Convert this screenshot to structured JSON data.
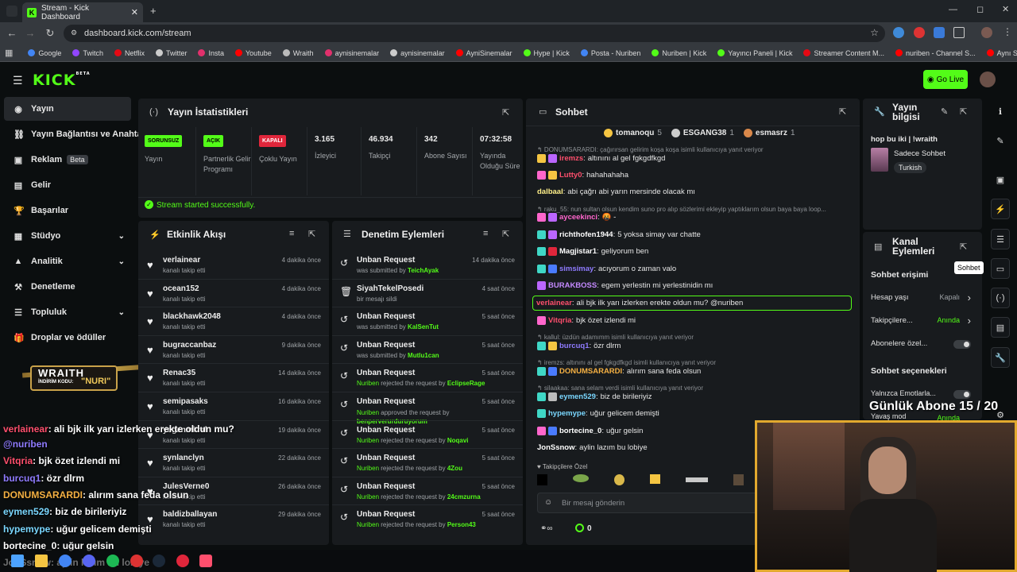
{
  "browser": {
    "tab_title": "Stream - Kick Dashboard",
    "url": "dashboard.kick.com/stream",
    "bookmarks": [
      {
        "label": "Google",
        "color": "#4285f4"
      },
      {
        "label": "Twitch",
        "color": "#9146ff"
      },
      {
        "label": "Netflix",
        "color": "#e50914"
      },
      {
        "label": "Twitter",
        "color": "#cccccc"
      },
      {
        "label": "Insta",
        "color": "#e1306c"
      },
      {
        "label": "Youtube",
        "color": "#ff0000"
      },
      {
        "label": "Wraith",
        "color": "#bbbbbb"
      },
      {
        "label": "aynisinemalar",
        "color": "#e1306c"
      },
      {
        "label": "aynisinemalar",
        "color": "#cccccc"
      },
      {
        "label": "AyniSinemalar",
        "color": "#ff0000"
      },
      {
        "label": "Hype | Kick",
        "color": "#53fc18"
      },
      {
        "label": "Posta - Nuriben",
        "color": "#4285f4"
      },
      {
        "label": "Nuriben | Kick",
        "color": "#53fc18"
      },
      {
        "label": "Yayıncı Paneli | Kick",
        "color": "#53fc18"
      },
      {
        "label": "Streamer Content M...",
        "color": "#e50914"
      },
      {
        "label": "nuriben - Channel S...",
        "color": "#ff0000"
      },
      {
        "label": "Aynı Sinemalar - Ça...",
        "color": "#ff0000"
      }
    ]
  },
  "header": {
    "logo": "KICK",
    "logo_sup": "BETA",
    "go_live": "Go Live"
  },
  "sidebar": {
    "items": [
      {
        "label": "Yayın",
        "icon": "broadcast-icon"
      },
      {
        "label": "Yayın Bağlantısı ve Anahtarı",
        "icon": "link-icon"
      },
      {
        "label": "Reklam",
        "icon": "ad-icon",
        "badge": "Beta"
      },
      {
        "label": "Gelir",
        "icon": "wallet-icon"
      },
      {
        "label": "Başarılar",
        "icon": "trophy-icon"
      },
      {
        "label": "Stüdyo",
        "icon": "studio-icon",
        "chevron": "⌄"
      },
      {
        "label": "Analitik",
        "icon": "chart-icon",
        "chevron": "⌄"
      },
      {
        "label": "Denetleme",
        "icon": "hammer-icon"
      },
      {
        "label": "Topluluk",
        "icon": "community-icon",
        "chevron": "⌄"
      },
      {
        "label": "Droplar ve ödüller",
        "icon": "gift-icon"
      }
    ]
  },
  "stats": {
    "title": "Yayın İstatistikleri",
    "items": [
      {
        "badge": "SORUNSUZ",
        "badge_color": "#53fc18",
        "label": "Yayın"
      },
      {
        "badge": "AÇIK",
        "badge_color": "#53fc18",
        "label": "Partnerlik Gelir Programı"
      },
      {
        "badge": "KAPALI",
        "badge_color": "#e0263b",
        "label": "Çoklu Yayın"
      },
      {
        "value": "3.165",
        "label": "İzleyici"
      },
      {
        "value": "46.934",
        "label": "Takipçi"
      },
      {
        "value": "342",
        "label": "Abone Sayısı"
      },
      {
        "value": "07:32:58",
        "label": "Yayında Olduğu Süre"
      }
    ],
    "success": "Stream started successfully."
  },
  "activity": {
    "title": "Etkinlik Akışı",
    "rows": [
      {
        "name": "verlainear",
        "sub": "kanalı takip etti",
        "time": "4 dakika önce"
      },
      {
        "name": "ocean152",
        "sub": "kanalı takip etti",
        "time": "4 dakika önce"
      },
      {
        "name": "blackhawk2048",
        "sub": "kanalı takip etti",
        "time": "4 dakika önce"
      },
      {
        "name": "bugraccanbaz",
        "sub": "kanalı takip etti",
        "time": "9 dakika önce"
      },
      {
        "name": "Renac35",
        "sub": "kanalı takip etti",
        "time": "14 dakika önce"
      },
      {
        "name": "semipasaks",
        "sub": "kanalı takip etti",
        "time": "16 dakika önce"
      },
      {
        "name": "yegenmkral",
        "sub": "kanalı takip etti",
        "time": "19 dakika önce"
      },
      {
        "name": "synlanclyn",
        "sub": "kanalı takip etti",
        "time": "22 dakika önce"
      },
      {
        "name": "JulesVerne0",
        "sub": "kanalı takip etti",
        "time": "26 dakika önce"
      },
      {
        "name": "baldizballayan",
        "sub": "kanalı takip etti",
        "time": "29 dakika önce"
      }
    ]
  },
  "moderation": {
    "title": "Denetim Eylemleri",
    "rows": [
      {
        "name": "Unban Request",
        "pre": "was submitted by ",
        "who": "TeichAyak",
        "time": "14 dakika önce",
        "icon": "undo-icon"
      },
      {
        "name": "SiyahTekelPosedi",
        "pre": "bir mesajı sildi",
        "who": "",
        "time": "4 saat önce",
        "icon": "trash-icon"
      },
      {
        "name": "Unban Request",
        "pre": "was submitted by ",
        "who": "KalSenTut",
        "time": "5 saat önce",
        "icon": "undo-icon"
      },
      {
        "name": "Unban Request",
        "pre": "was submitted by ",
        "who": "Mutlu1can",
        "time": "5 saat önce",
        "icon": "undo-icon"
      },
      {
        "name": "Unban Request",
        "by": "Nuriben",
        "pre": " rejected the request by ",
        "who": "EclipseRage",
        "time": "5 saat önce",
        "icon": "undo-icon"
      },
      {
        "name": "Unban Request",
        "by": "Nuriben",
        "pre": " approved the request by ",
        "who": "benperverurduruyorum",
        "time": "5 saat önce",
        "icon": "undo-icon"
      },
      {
        "name": "Unban Request",
        "by": "Nuriben",
        "pre": " rejected the request by ",
        "who": "Noqavi",
        "time": "5 saat önce",
        "icon": "undo-icon"
      },
      {
        "name": "Unban Request",
        "by": "Nuriben",
        "pre": " rejected the request by ",
        "who": "4Zou",
        "time": "5 saat önce",
        "icon": "undo-icon"
      },
      {
        "name": "Unban Request",
        "by": "Nuriben",
        "pre": " rejected the request by ",
        "who": "24cmzurna",
        "time": "5 saat önce",
        "icon": "undo-icon"
      },
      {
        "name": "Unban Request",
        "by": "Nuriben",
        "pre": " rejected the request by ",
        "who": "Person43",
        "time": "5 saat önce",
        "icon": "undo-icon"
      }
    ]
  },
  "chat": {
    "title": "Sohbet",
    "top_gifters": [
      {
        "name": "tomanoqu",
        "count": "5",
        "color": "#f5c542"
      },
      {
        "name": "ESGANG38",
        "count": "1",
        "color": "#cccccc"
      },
      {
        "name": "esmasrz",
        "count": "1",
        "color": "#d9884a"
      }
    ],
    "messages": [
      {
        "reply": "↰ DONUMSARARDI: çağırırsan gelirim koşa koşa isimli kullanıcıya yanıt veriyor"
      },
      {
        "user": "iremzs",
        "color": "#ff4f6d",
        "text": "altınını al gel fgkgdfkgd",
        "badges": [
          "#f5c542",
          "#bb66ff"
        ]
      },
      {
        "user": "Lutty0",
        "color": "#ff4f6d",
        "text": "hahahahaha",
        "badges": [
          "#ff66cc",
          "#f5c542"
        ]
      },
      {
        "user": "dalbaal",
        "color": "#fff08a",
        "text": "abi çağrı abi yarın mersinde olacak mı",
        "badges": []
      },
      {
        "reply": "↰ raku_55: nun sultan olsun kendim suno pro alıp sözlerimi ekleyip yaptıklarım olsun baya baya loop..."
      },
      {
        "user": "ayceekinci",
        "color": "#ff66cc",
        "text": "🤬 -",
        "badges": [
          "#ff66cc",
          "#bb66ff"
        ]
      },
      {
        "user": "richthofen1944",
        "color": "#ffffff",
        "text": "5 yoksa simay var chatte",
        "badges": [
          "#3fd7c6",
          "#bb66ff"
        ]
      },
      {
        "user": "Magjistar1",
        "color": "#ffffff",
        "text": "geliyorum ben",
        "badges": [
          "#3fd7c6",
          "#e0263b"
        ]
      },
      {
        "user": "simsimay",
        "color": "#8f7bff",
        "text": "acıyorum o zaman valo",
        "badges": [
          "#3fd7c6",
          "#4a7bff"
        ]
      },
      {
        "user": "BURAKBOSS",
        "color": "#c58aff",
        "text": "egem yerlestin mi yerlestinidin mı",
        "badges": [
          "#bb66ff"
        ]
      },
      {
        "user": "verlainear",
        "color": "#ff4f6d",
        "text": "ali bjk ilk yarı izlerken erekte oldun mu? @nuriben",
        "badges": [],
        "highlight": true
      },
      {
        "user": "Vitqria",
        "color": "#ff4f6d",
        "text": "bjk özet izlendi mi",
        "badges": [
          "#ff66cc"
        ]
      },
      {
        "reply": "↰ kallul: üzdün adamımm isimli kullanıcıya yanıt veriyor"
      },
      {
        "user": "burcuq1",
        "color": "#8f7bff",
        "text": "özr dlrm",
        "badges": [
          "#3fd7c6",
          "#f5c542"
        ]
      },
      {
        "reply": "↰ iremzs: altınını al gel fgkgdfkgd isimli kullanıcıya yanıt veriyor"
      },
      {
        "user": "DONUMSARARDI",
        "color": "#f5b042",
        "text": "alırım sana feda olsun",
        "badges": [
          "#3fd7c6",
          "#4a7bff"
        ]
      },
      {
        "reply": "↰ silaakaa: sana selam verdi isimli kullanıcıya yanıt veriyor"
      },
      {
        "user": "eymen529",
        "color": "#7ad7ff",
        "text": "biz de birileriyiz",
        "badges": [
          "#3fd7c6",
          "#bbbbbb"
        ]
      },
      {
        "user": "hypemype",
        "color": "#7ad7ff",
        "text": "uğur gelicem demişti",
        "badges": [
          "#3fd7c6"
        ]
      },
      {
        "user": "bortecine_0",
        "color": "#ffffff",
        "text": "uğur gelsin",
        "badges": [
          "#ff66cc",
          "#4a7bff"
        ]
      },
      {
        "user": "JonSsnow",
        "color": "#ffffff",
        "text": "aylin lazım bu lobiye",
        "badges": []
      }
    ],
    "emote_header": "♥ Takipçilere Özel",
    "input_placeholder": "Bir mesaj gönderin",
    "points": "0"
  },
  "info": {
    "title": "Yayın bilgisi",
    "stream_title": "hop bu iki | !wraith",
    "category": "Sadece Sohbet",
    "tag": "Turkish"
  },
  "channel": {
    "title": "Kanal Eylemleri",
    "chat_access": "Sohbet erişimi",
    "rows": [
      {
        "label": "Hesap yaşı",
        "value": "Kapalı",
        "vcolor": "#9ea2a6",
        "type": "chevron"
      },
      {
        "label": "Takipçilere...",
        "value": "Anında",
        "vcolor": "#53fc18",
        "type": "chevron"
      },
      {
        "label": "Abonelere özel...",
        "value": "",
        "type": "toggle"
      }
    ],
    "chat_options": "Sohbet seçenekleri",
    "rows2": [
      {
        "label": "Yalnızca Emotlarla...",
        "type": "toggle"
      },
      {
        "label": "Yavaş mod",
        "value": "Anında",
        "vcolor": "#53fc18"
      }
    ],
    "tooltip": "Sohbet"
  },
  "overlay": {
    "sponsor_brand": "WRAITH",
    "sponsor_code_label": "İNDİRİM KODU:",
    "sponsor_code": "\"NURI\"",
    "sub_goal": "Günlük Abone 15 / 20",
    "chat": [
      {
        "user": "verlainear",
        "color": "#ff4f6d",
        "text": ": ali bjk ilk yarı izlerken erekte oldun mu?"
      },
      {
        "user": "",
        "color": "#8f7bff",
        "text": "@nuriben"
      },
      {
        "user": "Vitqria",
        "color": "#ff4f6d",
        "text": ": bjk özet izlendi mi"
      },
      {
        "user": "burcuq1",
        "color": "#8f7bff",
        "text": ": özr dlrm"
      },
      {
        "user": "DONUMSARARDI",
        "color": "#f5b042",
        "text": ": alırım sana feda olsun"
      },
      {
        "user": "eymen529",
        "color": "#7ad7ff",
        "text": ": biz de birileriyiz"
      },
      {
        "user": "hypemype",
        "color": "#7ad7ff",
        "text": ": uğur gelicem demişti"
      },
      {
        "user": "bortecine_0",
        "color": "#ffffff",
        "text": ": uğur gelsin"
      },
      {
        "user": "JonSsnow",
        "color": "#ffffff",
        "text": ": aylin lazım bu lobiye"
      }
    ]
  }
}
